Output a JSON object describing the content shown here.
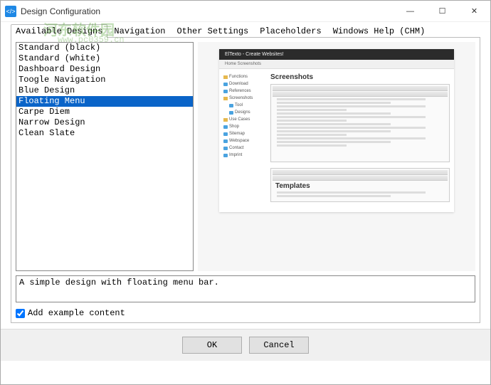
{
  "window": {
    "title": "Design Configuration"
  },
  "watermark": {
    "line1": "河东软件园",
    "line2": "www.pc0359.cn"
  },
  "tabs": [
    {
      "id": "available",
      "label": "Available Designs",
      "active": true
    },
    {
      "id": "navigation",
      "label": "Navigation"
    },
    {
      "id": "other",
      "label": "Other Settings"
    },
    {
      "id": "placeholders",
      "label": "Placeholders"
    },
    {
      "id": "chm",
      "label": "Windows Help (CHM)"
    }
  ],
  "designs": {
    "items": [
      {
        "label": "Standard (black)"
      },
      {
        "label": "Standard (white)"
      },
      {
        "label": "Dashboard Design"
      },
      {
        "label": "Toogle Navigation"
      },
      {
        "label": "Blue Design"
      },
      {
        "label": "Floating Menu",
        "selected": true
      },
      {
        "label": "Carpe Diem"
      },
      {
        "label": "Narrow Design"
      },
      {
        "label": "Clean Slate"
      }
    ]
  },
  "preview": {
    "header": "ElTexto - Create Websites!",
    "breadcrumb": "Home    Screenshots",
    "sidebar": [
      {
        "label": "Functions",
        "type": "folder"
      },
      {
        "label": "Download",
        "type": "doc"
      },
      {
        "label": "References",
        "type": "doc"
      },
      {
        "label": "Screenshots",
        "type": "folder"
      },
      {
        "label": "Tool",
        "type": "doc",
        "indent": 1
      },
      {
        "label": "Designs",
        "type": "doc",
        "indent": 1
      },
      {
        "label": "Use Cases",
        "type": "folder"
      },
      {
        "label": "Shop",
        "type": "doc"
      },
      {
        "label": "Sitemap",
        "type": "doc"
      },
      {
        "label": "Webspace",
        "type": "doc"
      },
      {
        "label": "Contact",
        "type": "doc"
      },
      {
        "label": "Imprint",
        "type": "doc"
      }
    ],
    "heading1": "Screenshots",
    "heading2": "Templates"
  },
  "description": "A simple design with floating menu bar.",
  "checkbox": {
    "label": "Add example content",
    "checked": true
  },
  "buttons": {
    "ok": "OK",
    "cancel": "Cancel"
  }
}
